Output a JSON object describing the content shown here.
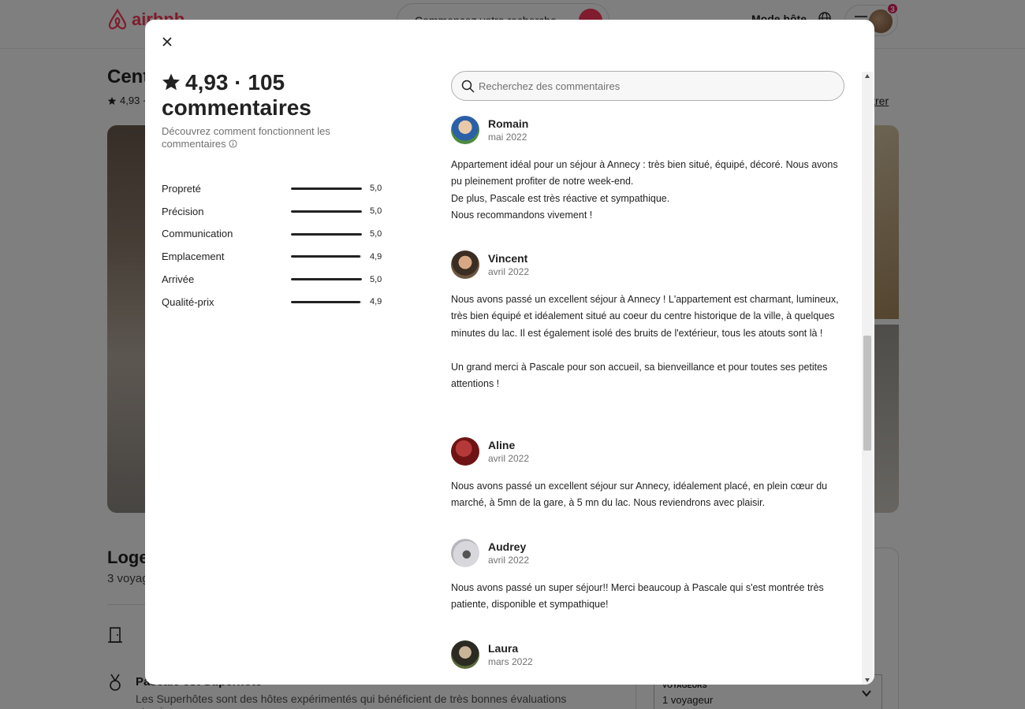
{
  "background": {
    "logo_text": "airbnb",
    "search_placeholder": "Commencez votre recherche",
    "host_mode": "Mode hôte",
    "notification_count": "3",
    "listing_title": "Cent",
    "listing_rating": "4,93 ·",
    "save_link": "istrer",
    "lodging_title": "Loge",
    "lodging_sub": "3 voyag",
    "feature_title": "Pascale est Superhôte",
    "feature_desc": "Les Superhôtes sont des hôtes expérimentés qui bénéficient de très bonnes évaluations et qui",
    "guests_label": "VOYAGEURS",
    "guests_value": "1 voyageur"
  },
  "modal": {
    "summary": {
      "rating": "4,93 · 105",
      "count_label": "commentaires",
      "how_link": "Découvrez comment fonctionnent les commentaires"
    },
    "categories": [
      {
        "label": "Propreté",
        "value": "5,0",
        "score": 5.0
      },
      {
        "label": "Précision",
        "value": "5,0",
        "score": 5.0
      },
      {
        "label": "Communication",
        "value": "5,0",
        "score": 5.0
      },
      {
        "label": "Emplacement",
        "value": "4,9",
        "score": 4.9
      },
      {
        "label": "Arrivée",
        "value": "5,0",
        "score": 5.0
      },
      {
        "label": "Qualité-prix",
        "value": "4,9",
        "score": 4.9
      }
    ],
    "search": {
      "placeholder": "Recherchez des commentaires"
    },
    "reviews": [
      {
        "name": "Romain",
        "date": "mai 2022",
        "text": "Appartement idéal pour un séjour à Annecy : très bien situé, équipé, décoré. Nous avons pu pleinement profiter de notre week-end.\nDe plus, Pascale est très réactive et sympathique.\nNous recommandons vivement !"
      },
      {
        "name": "Vincent",
        "date": "avril 2022",
        "text": "Nous avons passé un excellent séjour à Annecy ! L'appartement est charmant, lumineux, très bien équipé et idéalement situé au coeur du centre historique de la ville, à quelques minutes du lac. Il est également isolé des bruits de l'extérieur, tous les atouts sont là !\n\nUn grand merci à Pascale pour son accueil, sa bienveillance et pour toutes ses petites attentions !"
      },
      {
        "name": "Aline",
        "date": "avril 2022",
        "text": "Nous avons passé un excellent séjour sur Annecy, idéalement placé, en plein cœur du marché, à 5mn de la gare, à 5 mn du lac. Nous reviendrons avec plaisir."
      },
      {
        "name": "Audrey",
        "date": "avril 2022",
        "text": "Nous avons passé un super séjour!! Merci beaucoup à Pascale qui s'est montrée très patiente, disponible et sympathique!"
      },
      {
        "name": "Laura",
        "date": "mars 2022",
        "text": ""
      }
    ]
  }
}
